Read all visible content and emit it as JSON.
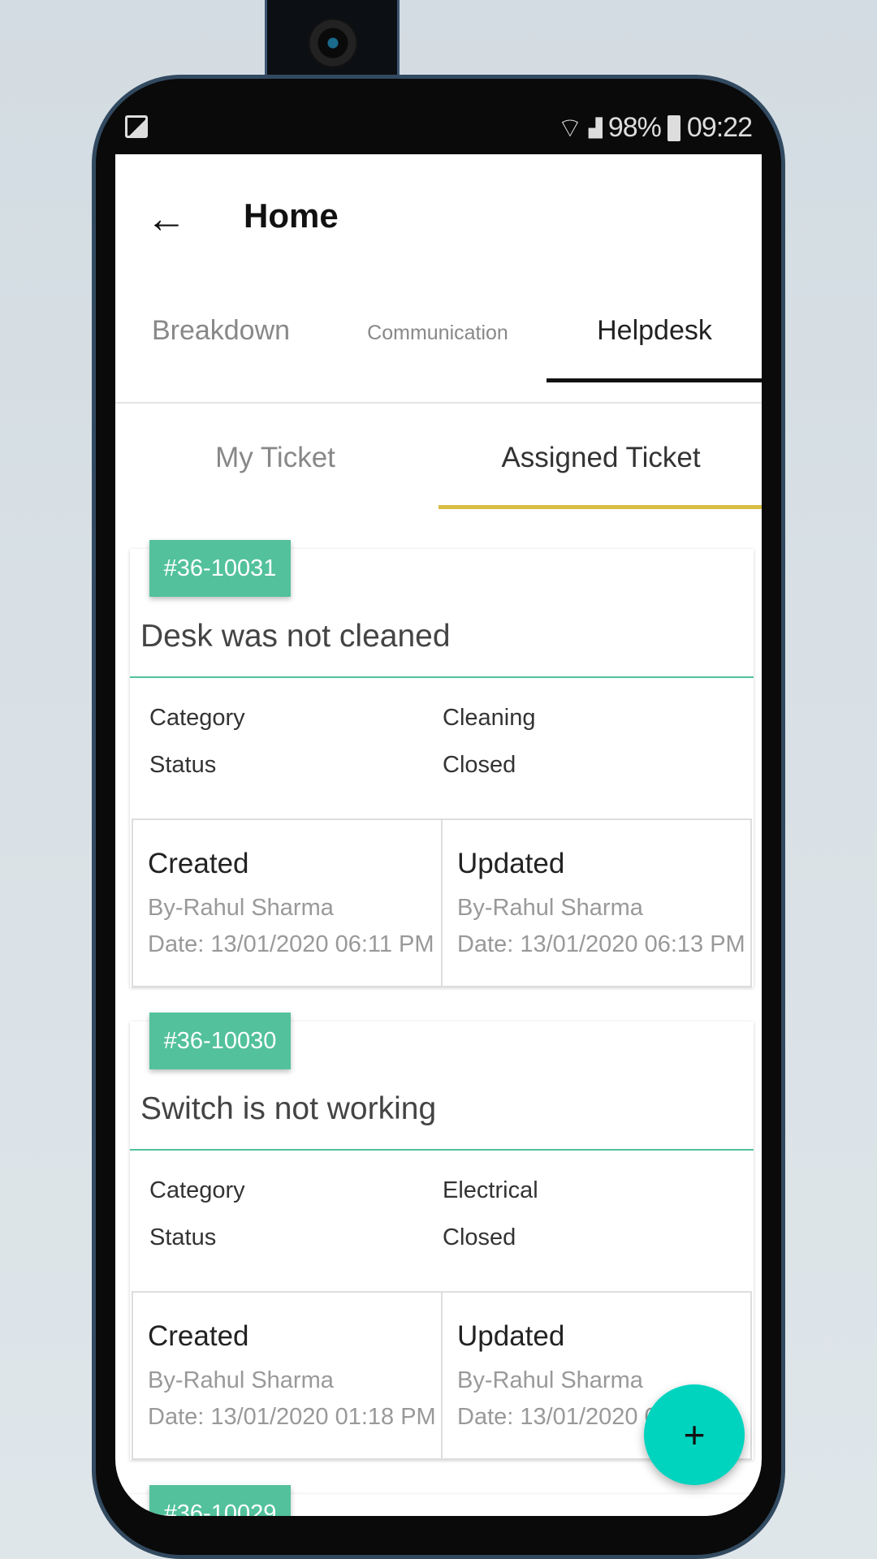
{
  "status_bar": {
    "battery": "98%",
    "time": "09:22"
  },
  "header": {
    "title": "Home"
  },
  "tabs": [
    {
      "label": "Breakdown"
    },
    {
      "label": "Communication"
    },
    {
      "label": "Helpdesk",
      "active": true
    }
  ],
  "sub_tabs": [
    {
      "label": "My Ticket"
    },
    {
      "label": "Assigned Ticket",
      "active": true
    }
  ],
  "tickets": [
    {
      "id": "#36-10031",
      "title": "Desk was not cleaned",
      "category_label": "Category",
      "category": "Cleaning",
      "status_label": "Status",
      "status": "Closed",
      "created": {
        "label": "Created",
        "by": "By-Rahul Sharma",
        "date": "Date: 13/01/2020 06:11 PM"
      },
      "updated": {
        "label": "Updated",
        "by": "By-Rahul Sharma",
        "date": "Date: 13/01/2020 06:13 PM"
      }
    },
    {
      "id": "#36-10030",
      "title": "Switch is not working",
      "category_label": "Category",
      "category": "Electrical",
      "status_label": "Status",
      "status": "Closed",
      "created": {
        "label": "Created",
        "by": "By-Rahul Sharma",
        "date": "Date: 13/01/2020 01:18 PM"
      },
      "updated": {
        "label": "Updated",
        "by": "By-Rahul Sharma",
        "date": "Date: 13/01/2020 0"
      }
    },
    {
      "id": "#36-10029"
    }
  ],
  "fab": {
    "label": "+"
  },
  "colors": {
    "accent": "#52c19c",
    "fab": "#00d4bf",
    "subtab_indicator": "#d9bd45"
  }
}
